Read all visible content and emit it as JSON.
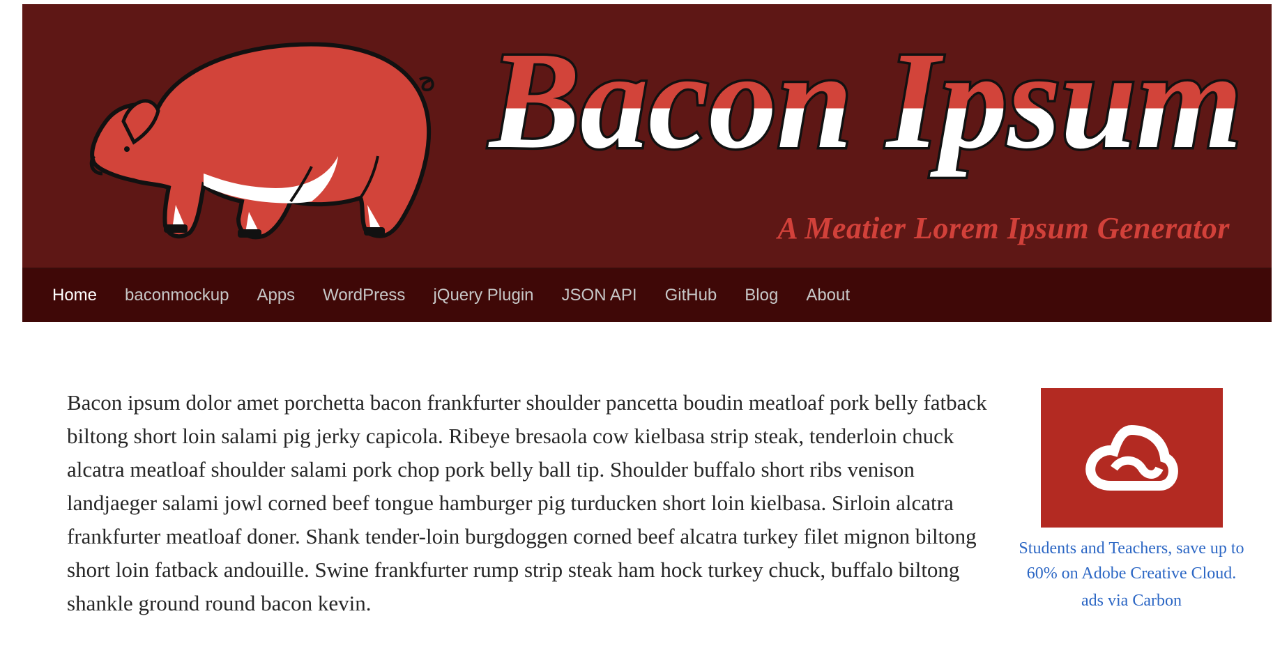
{
  "header": {
    "logo_text": "Bacon Ipsum",
    "tagline": "A Meatier Lorem Ipsum Generator"
  },
  "nav": {
    "items": [
      {
        "label": "Home",
        "active": true
      },
      {
        "label": "baconmockup"
      },
      {
        "label": "Apps"
      },
      {
        "label": "WordPress"
      },
      {
        "label": "jQuery Plugin"
      },
      {
        "label": "JSON API"
      },
      {
        "label": "GitHub"
      },
      {
        "label": "Blog"
      },
      {
        "label": "About"
      }
    ]
  },
  "main": {
    "paragraph": "Bacon ipsum dolor amet porchetta bacon frankfurter shoulder pancetta boudin meatloaf pork belly fatback biltong short loin salami pig jerky capicola. Ribeye bresaola cow kielbasa strip steak, tenderloin chuck alcatra meatloaf shoulder salami pork chop pork belly ball tip. Shoulder buffalo short ribs venison landjaeger salami jowl corned beef tongue hamburger pig turducken short loin kielbasa. Sirloin alcatra frankfurter meatloaf doner. Shank tender-loin burgdoggen corned beef alcatra turkey filet mignon biltong short loin fatback andouille. Swine frankfurter rump strip steak ham hock turkey chuck, buffalo biltong shankle ground round bacon kevin."
  },
  "ad": {
    "icon": "adobe-creative-cloud-icon",
    "text": "Students and Teachers, save up to 60% on Adobe Creative Cloud.",
    "via": "ads via Carbon"
  },
  "colors": {
    "header_bg": "#5e1715",
    "nav_bg": "#3f0807",
    "pig": "#d2443a",
    "tagline": "#d2413a",
    "ad_bg": "#b32a22",
    "link": "#2b66c4"
  }
}
